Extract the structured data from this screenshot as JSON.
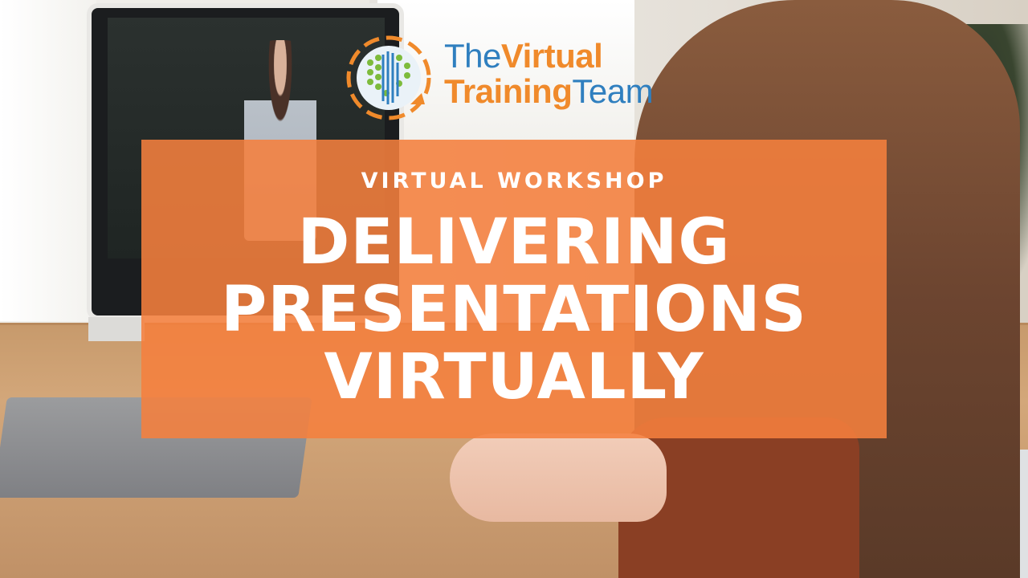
{
  "logo": {
    "word_the": "The",
    "word_virtual": "Virtual",
    "word_training": "Training",
    "word_team": "Team",
    "colors": {
      "blue": "#2f7fbf",
      "orange": "#f08a2b",
      "green": "#7dbb3c"
    },
    "icon": "globe-icon"
  },
  "banner": {
    "kicker": "VIRTUAL WORKSHOP",
    "headline": [
      "DELIVERING",
      "PRESENTATIONS",
      "VIRTUALLY"
    ],
    "color": "#f5803e"
  }
}
